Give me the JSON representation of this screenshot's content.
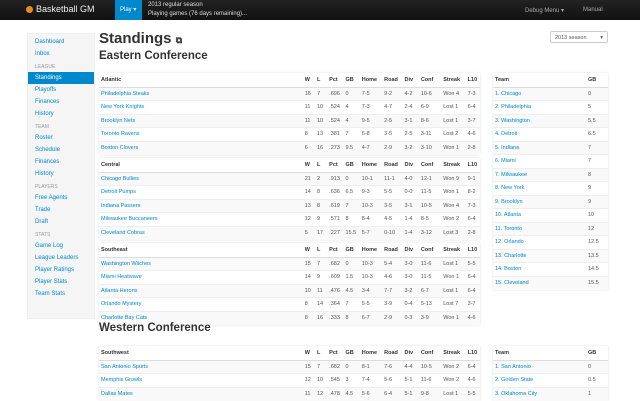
{
  "nav": {
    "brand": "Basketball GM",
    "play": "Play ▾",
    "season_line": "2013 regular season",
    "status_line": "Playing games (76 days remaining)...",
    "debug": "Debug Menu ▾",
    "manual": "Manual"
  },
  "sidebar": [
    {
      "type": "item",
      "label": "Dashboard"
    },
    {
      "type": "item",
      "label": "Inbox"
    },
    {
      "type": "header",
      "label": "LEAGUE"
    },
    {
      "type": "item",
      "label": "Standings",
      "active": true
    },
    {
      "type": "item",
      "label": "Playoffs"
    },
    {
      "type": "item",
      "label": "Finances"
    },
    {
      "type": "item",
      "label": "History"
    },
    {
      "type": "header",
      "label": "TEAM"
    },
    {
      "type": "item",
      "label": "Roster"
    },
    {
      "type": "item",
      "label": "Schedule"
    },
    {
      "type": "item",
      "label": "Finances"
    },
    {
      "type": "item",
      "label": "History"
    },
    {
      "type": "header",
      "label": "PLAYERS"
    },
    {
      "type": "item",
      "label": "Free Agents"
    },
    {
      "type": "item",
      "label": "Trade"
    },
    {
      "type": "item",
      "label": "Draft"
    },
    {
      "type": "header",
      "label": "STATS"
    },
    {
      "type": "item",
      "label": "Game Log"
    },
    {
      "type": "item",
      "label": "League Leaders"
    },
    {
      "type": "item",
      "label": "Player Ratings"
    },
    {
      "type": "item",
      "label": "Player Stats"
    },
    {
      "type": "item",
      "label": "Team Stats"
    }
  ],
  "page": {
    "title": "Standings",
    "season_select": "2013 season"
  },
  "columns": [
    "W",
    "L",
    "Pct",
    "GB",
    "Home",
    "Road",
    "Div",
    "Conf",
    "Streak",
    "L10"
  ],
  "conference_columns": [
    "Team",
    "GB"
  ],
  "conferences": [
    {
      "name": "Eastern Conference",
      "divisions": [
        {
          "name": "Atlantic",
          "rows": [
            [
              "Philadelphia Steaks",
              "16",
              "7",
              ".696",
              "0",
              "7-5",
              "9-2",
              "4-2",
              "10-6",
              "Won 4",
              "7-3"
            ],
            [
              "New York Knights",
              "11",
              "10",
              ".524",
              "4",
              "7-3",
              "4-7",
              "2-4",
              "6-9",
              "Lost 1",
              "6-4"
            ],
            [
              "Brooklyn Nets",
              "11",
              "10",
              ".524",
              "4",
              "9-5",
              "2-5",
              "3-1",
              "8-6",
              "Lost 1",
              "3-7"
            ],
            [
              "Toronto Ravens",
              "8",
              "13",
              ".381",
              "7",
              "5-8",
              "3-5",
              "2-5",
              "3-11",
              "Lost 2",
              "4-6"
            ],
            [
              "Boston Clovers",
              "6",
              "16",
              ".273",
              "9.5",
              "4-7",
              "2-9",
              "3-2",
              "3-10",
              "Won 1",
              "2-8"
            ]
          ]
        },
        {
          "name": "Central",
          "rows": [
            [
              "Chicago Bullies",
              "21",
              "2",
              ".913",
              "0",
              "10-1",
              "11-1",
              "4-0",
              "12-1",
              "Won 9",
              "9-1"
            ],
            [
              "Detroit Pumps",
              "14",
              "8",
              ".636",
              "6.5",
              "9-3",
              "5-5",
              "0-0",
              "11-5",
              "Won 1",
              "8-2"
            ],
            [
              "Indiana Passers",
              "13",
              "8",
              ".619",
              "7",
              "10-3",
              "3-5",
              "3-1",
              "10-5",
              "Won 4",
              "7-3"
            ],
            [
              "Milwaukee Buccaneers",
              "12",
              "9",
              ".571",
              "8",
              "8-4",
              "4-5",
              "1-4",
              "8-5",
              "Won 2",
              "6-4"
            ],
            [
              "Cleveland Cobras",
              "5",
              "17",
              ".227",
              "15.5",
              "5-7",
              "0-10",
              "1-4",
              "3-12",
              "Lost 3",
              "2-8"
            ]
          ]
        },
        {
          "name": "Southeast",
          "rows": [
            [
              "Washington Witches",
              "15",
              "7",
              ".682",
              "0",
              "10-3",
              "5-4",
              "3-0",
              "11-6",
              "Lost 1",
              "5-5"
            ],
            [
              "Miami Heatwave",
              "14",
              "9",
              ".609",
              "1.5",
              "10-3",
              "4-6",
              "3-0",
              "11-5",
              "Won 1",
              "6-4"
            ],
            [
              "Atlanta Herons",
              "10",
              "11",
              ".476",
              "4.5",
              "3-4",
              "7-7",
              "3-2",
              "6-7",
              "Lost 1",
              "6-4"
            ],
            [
              "Orlando Mystery",
              "8",
              "14",
              ".364",
              "7",
              "5-5",
              "3-9",
              "0-4",
              "5-13",
              "Lost 7",
              "3-7"
            ],
            [
              "Charlotte Bay Cats",
              "8",
              "16",
              ".333",
              "8",
              "6-7",
              "2-9",
              "0-3",
              "3-9",
              "Won 1",
              "4-6"
            ]
          ]
        }
      ],
      "ranking": [
        [
          "1. Chicago",
          "0"
        ],
        [
          "2. Philadelphia",
          "5"
        ],
        [
          "3. Washington",
          "5.5"
        ],
        [
          "4. Detroit",
          "6.5"
        ],
        [
          "5. Indiana",
          "7"
        ],
        [
          "6. Miami",
          "7"
        ],
        [
          "7. Milwaukee",
          "8"
        ],
        [
          "8. New York",
          "9"
        ],
        [
          "9. Brooklyn",
          "9"
        ],
        [
          "10. Atlanta",
          "10"
        ],
        [
          "11. Toronto",
          "12"
        ],
        [
          "12. Orlando",
          "12.5"
        ],
        [
          "13. Charlotte",
          "13.5"
        ],
        [
          "14. Boston",
          "14.5"
        ],
        [
          "15. Cleveland",
          "15.5"
        ]
      ]
    },
    {
      "name": "Western Conference",
      "divisions": [
        {
          "name": "Southwest",
          "rows": [
            [
              "San Antonio Spurts",
              "15",
              "7",
              ".682",
              "0",
              "8-1",
              "7-6",
              "4-4",
              "10-5",
              "Won 2",
              "6-4"
            ],
            [
              "Memphis Growls",
              "12",
              "10",
              ".545",
              "3",
              "7-4",
              "5-6",
              "5-1",
              "11-6",
              "Won 2",
              "4-6"
            ],
            [
              "Dallas Mates",
              "11",
              "12",
              ".478",
              "4.5",
              "5-6",
              "6-4",
              "5-1",
              "9-8",
              "Lost 1",
              "5-5"
            ]
          ]
        }
      ],
      "ranking": [
        [
          "1. San Antonio",
          "0"
        ],
        [
          "2. Golden State",
          "0.5"
        ],
        [
          "3. Oklahoma City",
          "1"
        ]
      ]
    }
  ]
}
